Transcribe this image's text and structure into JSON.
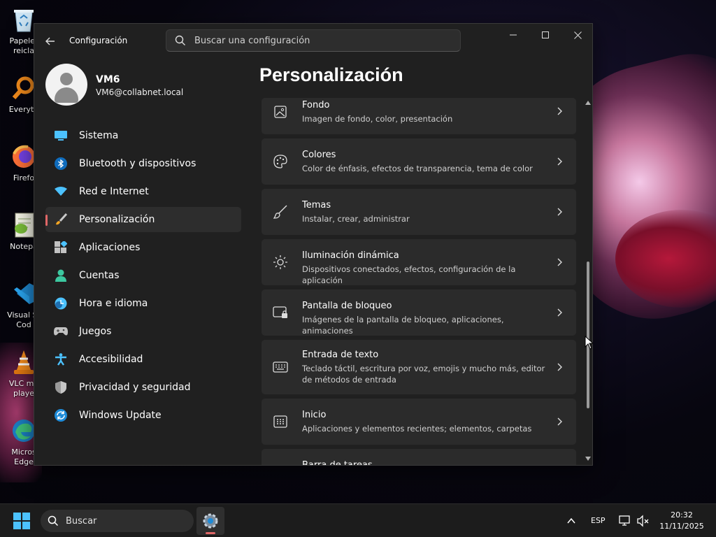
{
  "desktop": {
    "icons": [
      {
        "label": "Papeler reicla",
        "icon": "recycle-bin-icon"
      },
      {
        "label": "Everyth",
        "icon": "everything-search-icon"
      },
      {
        "label": "Firefo",
        "icon": "firefox-icon"
      },
      {
        "label": "Notepa",
        "icon": "notepad-plus-plus-icon"
      },
      {
        "label": "Visual St Cod",
        "icon": "vscode-icon"
      },
      {
        "label": "VLC me playe",
        "icon": "vlc-icon"
      },
      {
        "label": "Micros Edge",
        "icon": "edge-icon"
      }
    ]
  },
  "window": {
    "title": "Configuración",
    "search_placeholder": "Buscar una configuración",
    "controls": [
      "minimize",
      "maximize",
      "close"
    ]
  },
  "account": {
    "name": "VM6",
    "email": "VM6@collabnet.local"
  },
  "nav": {
    "items": [
      {
        "label": "Sistema",
        "icon": "system-monitor-icon",
        "color": "#4cc2ff"
      },
      {
        "label": "Bluetooth y dispositivos",
        "icon": "bluetooth-icon",
        "color": "#4cc2ff"
      },
      {
        "label": "Red e Internet",
        "icon": "wifi-icon",
        "color": "#4cc2ff"
      },
      {
        "label": "Personalización",
        "icon": "paintbrush-icon",
        "active": true
      },
      {
        "label": "Aplicaciones",
        "icon": "apps-icon"
      },
      {
        "label": "Cuentas",
        "icon": "accounts-icon",
        "color": "#3cc8a0"
      },
      {
        "label": "Hora e idioma",
        "icon": "time-language-icon"
      },
      {
        "label": "Juegos",
        "icon": "gamepad-icon"
      },
      {
        "label": "Accesibilidad",
        "icon": "accessibility-icon",
        "color": "#4cc2ff"
      },
      {
        "label": "Privacidad y seguridad",
        "icon": "shield-icon"
      },
      {
        "label": "Windows Update",
        "icon": "windows-update-icon",
        "color": "#4cc2ff"
      }
    ]
  },
  "main": {
    "title": "Personalización",
    "cards": [
      {
        "title": "Fondo",
        "desc": "Imagen de fondo, color, presentación",
        "icon": "background-image-icon"
      },
      {
        "title": "Colores",
        "desc": "Color de énfasis, efectos de transparencia, tema de color",
        "icon": "palette-icon"
      },
      {
        "title": "Temas",
        "desc": "Instalar, crear, administrar",
        "icon": "brush-icon"
      },
      {
        "title": "Iluminación dinámica",
        "desc": "Dispositivos conectados, efectos, configuración de la aplicación",
        "icon": "dynamic-lighting-icon"
      },
      {
        "title": "Pantalla de bloqueo",
        "desc": "Imágenes de la pantalla de bloqueo, aplicaciones, animaciones",
        "icon": "lock-screen-icon"
      },
      {
        "title": "Entrada de texto",
        "desc": "Teclado táctil, escritura por voz, emojis y mucho más, editor de métodos de entrada",
        "icon": "keyboard-icon"
      },
      {
        "title": "Inicio",
        "desc": "Aplicaciones y elementos recientes; elementos, carpetas",
        "icon": "start-menu-icon"
      },
      {
        "title": "Barra de tareas",
        "desc": "",
        "icon": "taskbar-icon"
      }
    ]
  },
  "taskbar": {
    "search_label": "Buscar",
    "language": "ESP",
    "time": "20:32",
    "date": "11/11/2025"
  }
}
